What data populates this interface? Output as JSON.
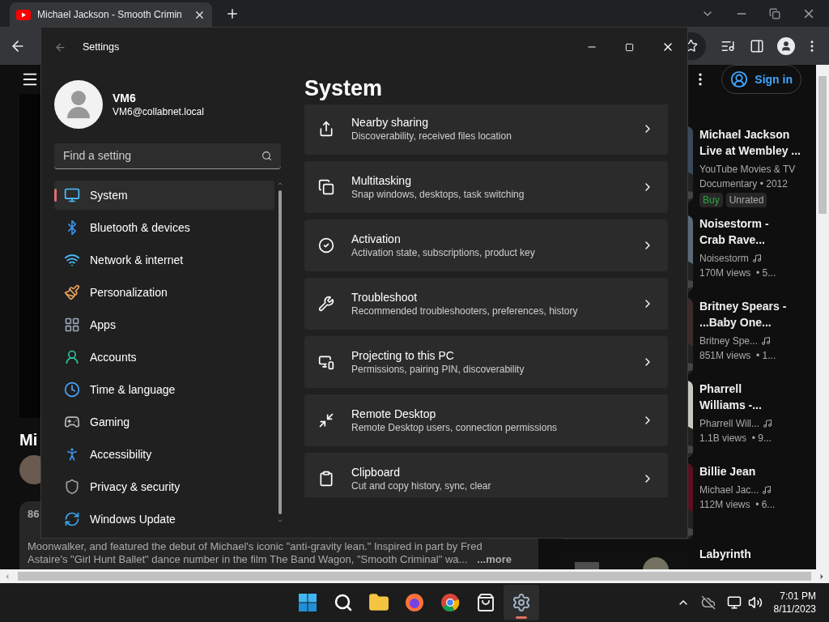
{
  "browser": {
    "tab": {
      "title": "Michael Jackson - Smooth Crimin"
    }
  },
  "youtube": {
    "sign_in": "Sign in",
    "video_title": "Mi",
    "description": {
      "head": "86",
      "lines": [
        "Moonwalker, and featured the debut of Michael's iconic \"anti-gravity lean.\" Inspired in part by Fred",
        "Astaire's \"Girl Hunt Ballet\" dance number in the film The Band Wagon, \"Smooth Criminal\" wa..."
      ],
      "more": "...more"
    },
    "related": [
      {
        "kind": "movie",
        "title_lines": [
          "Michael Jackson",
          "Live at Wembley ..."
        ],
        "channel": "YouTube Movies & TV",
        "meta": "Documentary • 2012",
        "badges": [
          {
            "label": "Buy",
            "kind": "price"
          },
          {
            "label": "Unrated",
            "kind": "rating"
          }
        ]
      },
      {
        "kind": "video",
        "title_lines": [
          "Noisestorm -",
          "Crab Rave..."
        ],
        "channel": "Noisestorm",
        "meta": "170M views  • 5..."
      },
      {
        "kind": "video",
        "title_lines": [
          "Britney Spears -",
          "...Baby One..."
        ],
        "channel": "Britney Spe...",
        "meta": "851M views  • 1..."
      },
      {
        "kind": "video",
        "title_lines": [
          "Pharrell",
          "Williams -..."
        ],
        "channel": "Pharrell Will...",
        "meta": "1.1B views  • 9..."
      },
      {
        "kind": "video",
        "title_lines": [
          "Billie Jean"
        ],
        "channel": "Michael Jac...",
        "meta": "112M views  • 6..."
      },
      {
        "kind": "video",
        "title_lines": [
          "Labyrinth"
        ]
      }
    ]
  },
  "settings": {
    "title": "Settings",
    "user": {
      "name": "VM6",
      "email": "VM6@collabnet.local"
    },
    "search": {
      "placeholder": "Find a setting"
    },
    "nav": [
      {
        "kind": "system",
        "label": "System",
        "selected": true
      },
      {
        "kind": "bluetooth",
        "label": "Bluetooth & devices",
        "selected": false
      },
      {
        "kind": "network",
        "label": "Network & internet",
        "selected": false
      },
      {
        "kind": "personalization",
        "label": "Personalization",
        "selected": false
      },
      {
        "kind": "apps",
        "label": "Apps",
        "selected": false
      },
      {
        "kind": "accounts",
        "label": "Accounts",
        "selected": false
      },
      {
        "kind": "time",
        "label": "Time & language",
        "selected": false
      },
      {
        "kind": "gaming",
        "label": "Gaming",
        "selected": false
      },
      {
        "kind": "accessibility",
        "label": "Accessibility",
        "selected": false
      },
      {
        "kind": "privacy",
        "label": "Privacy & security",
        "selected": false
      },
      {
        "kind": "update",
        "label": "Windows Update",
        "selected": false
      }
    ],
    "heading": "System",
    "cards": [
      {
        "kind": "sharing",
        "title": "Nearby sharing",
        "subtitle": "Discoverability, received files location"
      },
      {
        "kind": "multitasking",
        "title": "Multitasking",
        "subtitle": "Snap windows, desktops, task switching"
      },
      {
        "kind": "activation",
        "title": "Activation",
        "subtitle": "Activation state, subscriptions, product key"
      },
      {
        "kind": "troubleshoot",
        "title": "Troubleshoot",
        "subtitle": "Recommended troubleshooters, preferences, history"
      },
      {
        "kind": "projecting",
        "title": "Projecting to this PC",
        "subtitle": "Permissions, pairing PIN, discoverability"
      },
      {
        "kind": "remote",
        "title": "Remote Desktop",
        "subtitle": "Remote Desktop users, connection permissions"
      },
      {
        "kind": "clipboard",
        "title": "Clipboard",
        "subtitle": "Cut and copy history, sync, clear"
      }
    ]
  },
  "taskbar": {
    "apps": [
      {
        "kind": "start",
        "selected": false
      },
      {
        "kind": "search",
        "selected": false
      },
      {
        "kind": "explorer",
        "selected": false
      },
      {
        "kind": "firefox",
        "selected": false
      },
      {
        "kind": "chrome",
        "selected": false
      },
      {
        "kind": "store",
        "selected": false
      },
      {
        "kind": "settings",
        "selected": true
      }
    ],
    "time": "7:01 PM",
    "date": "8/11/2023"
  }
}
